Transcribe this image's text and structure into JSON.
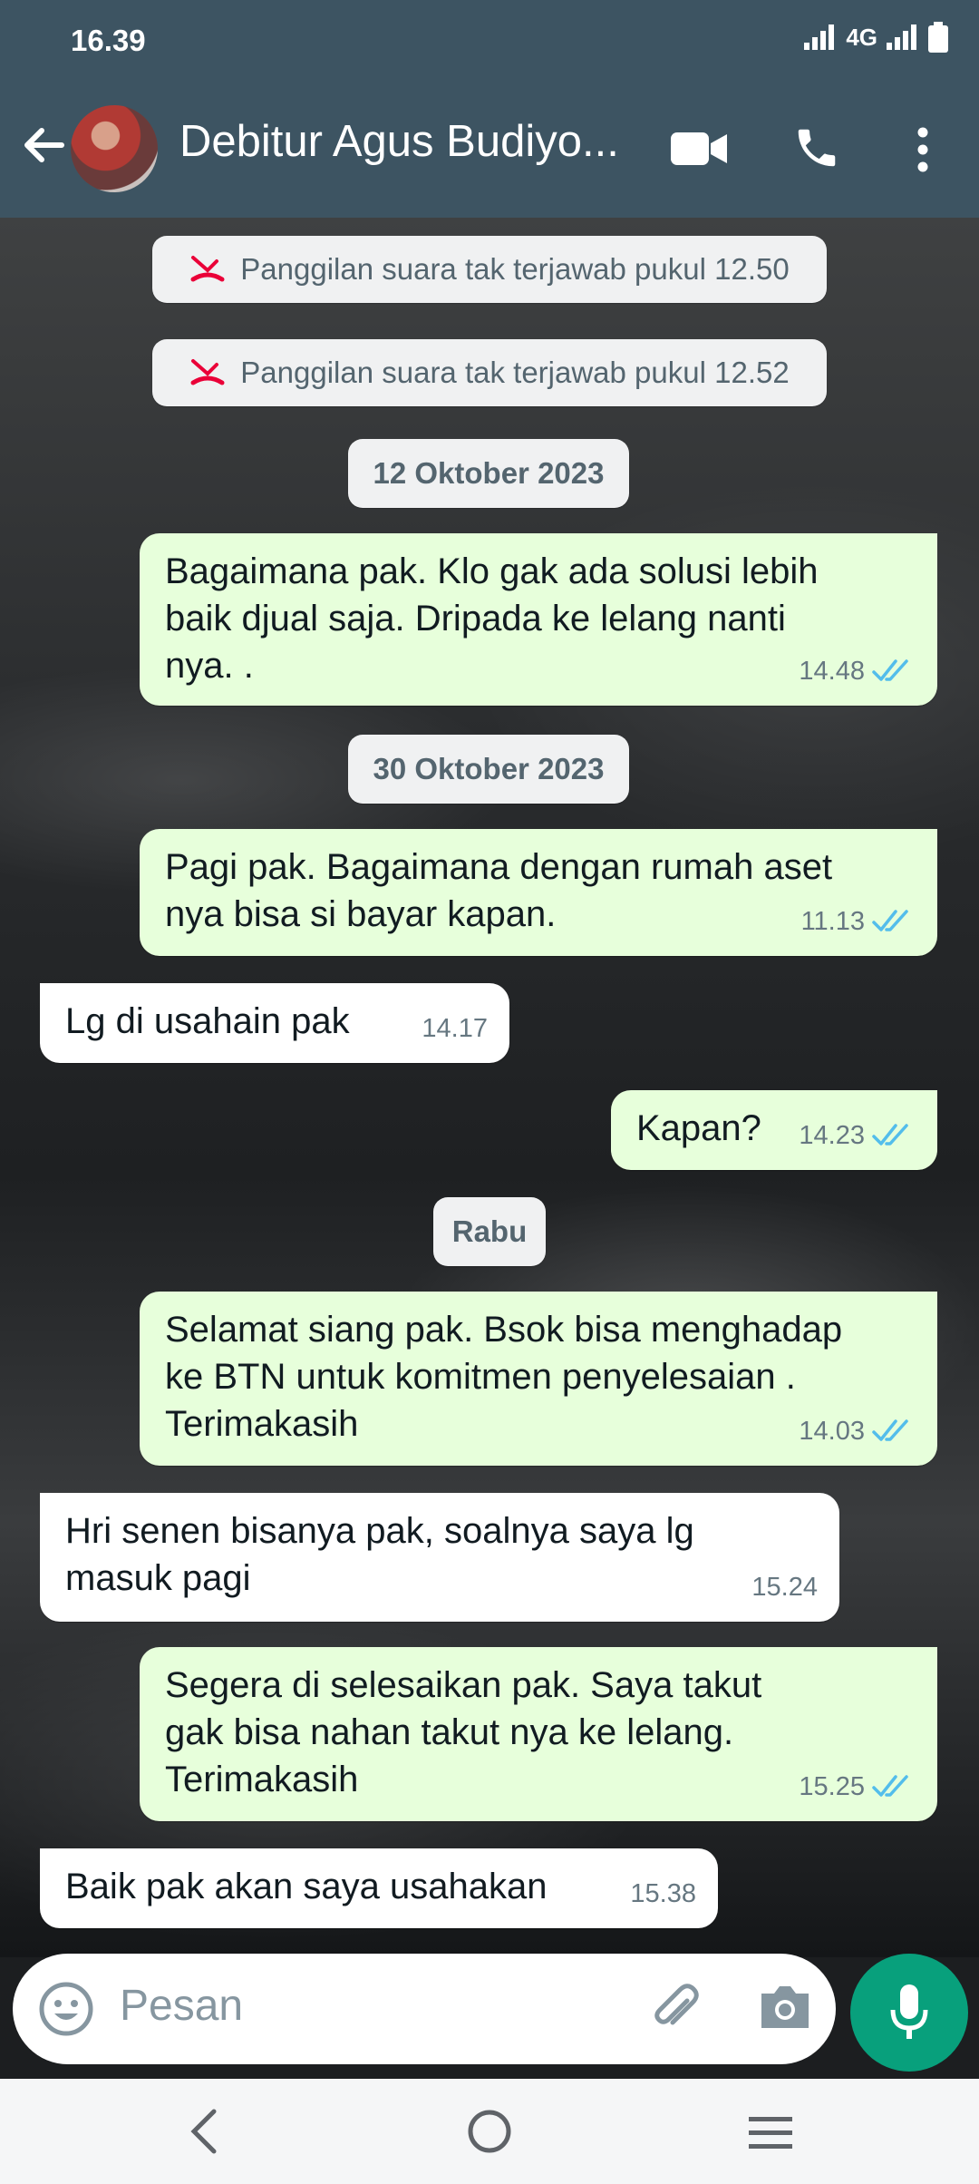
{
  "status_bar": {
    "time": "16.39",
    "network": "4G"
  },
  "header": {
    "contact_name": "Debitur Agus Budiyo..."
  },
  "messages": [
    {
      "kind": "missed_call",
      "text": "Panggilan suara tak terjawab pukul 12.50"
    },
    {
      "kind": "missed_call",
      "text": "Panggilan suara tak terjawab pukul 12.52"
    },
    {
      "kind": "date",
      "text": "12 Oktober 2023"
    },
    {
      "kind": "outgoing",
      "text": "Bagaimana pak. Klo gak ada solusi lebih\nbaik djual saja. Dripada ke lelang nanti\nnya. .",
      "time": "14.48",
      "status": "read"
    },
    {
      "kind": "date",
      "text": "30 Oktober 2023"
    },
    {
      "kind": "outgoing",
      "text": "Pagi pak. Bagaimana dengan rumah aset\nnya bisa si bayar kapan.",
      "time": "11.13",
      "status": "read"
    },
    {
      "kind": "incoming",
      "text": "Lg di usahain pak",
      "time": "14.17"
    },
    {
      "kind": "outgoing",
      "text": "Kapan?",
      "time": "14.23",
      "status": "read"
    },
    {
      "kind": "date",
      "text": "Rabu"
    },
    {
      "kind": "outgoing",
      "text": "Selamat siang pak. Bsok bisa menghadap\nke BTN untuk komitmen penyelesaian .\nTerimakasih",
      "time": "14.03",
      "status": "read"
    },
    {
      "kind": "incoming",
      "text": "Hri senen bisanya pak, soalnya saya lg\nmasuk pagi",
      "time": "15.24"
    },
    {
      "kind": "outgoing",
      "text": "Segera di selesaikan pak. Saya takut\ngak bisa nahan takut nya ke lelang.\nTerimakasih",
      "time": "15.25",
      "status": "read"
    },
    {
      "kind": "incoming",
      "text": "Baik pak akan saya usahakan",
      "time": "15.38"
    }
  ],
  "input": {
    "placeholder": "Pesan"
  },
  "colors": {
    "header": "#3d5462",
    "outgoing_bubble": "#e7ffdb",
    "incoming_bubble": "#ffffff",
    "read_tick": "#53bdeb",
    "mic_button": "#08a07c",
    "missed_call_icon": "#ea0038"
  },
  "icons": [
    "back-arrow-icon",
    "video-call-icon",
    "voice-call-icon",
    "more-options-icon",
    "missed-call-icon",
    "double-check-icon",
    "emoji-icon",
    "attach-icon",
    "camera-icon",
    "mic-icon",
    "nav-back-icon",
    "nav-home-icon",
    "nav-recents-icon"
  ]
}
